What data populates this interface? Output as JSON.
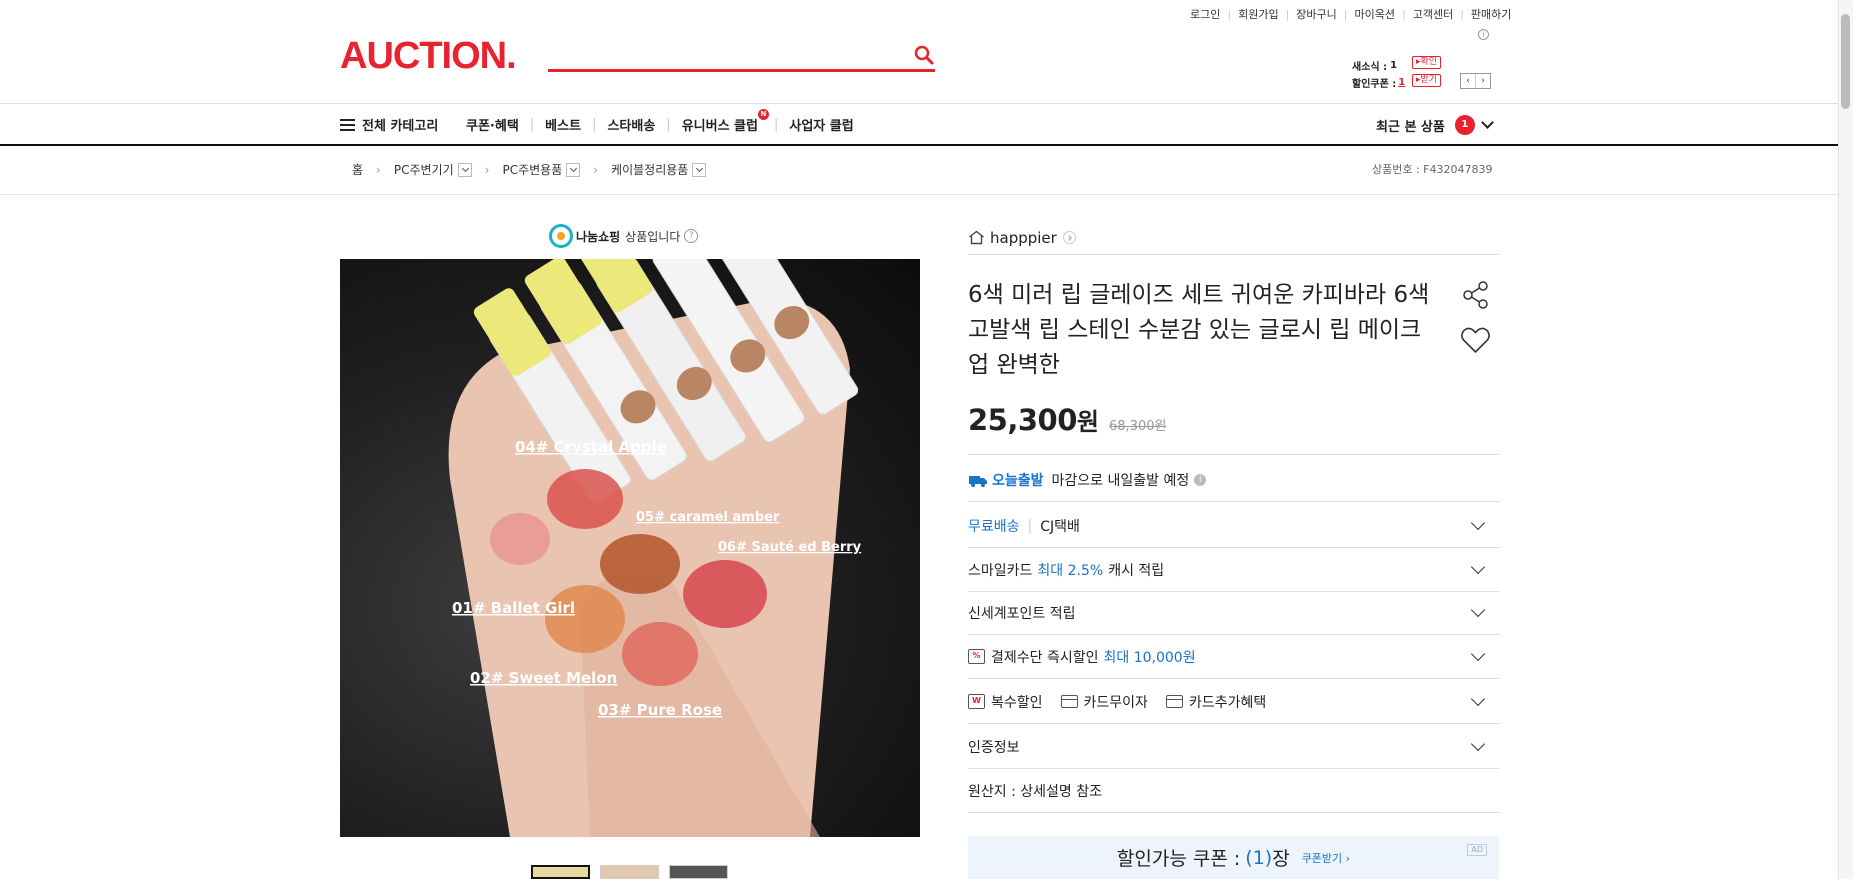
{
  "util_links": [
    "로그인",
    "회원가입",
    "장바구니",
    "마이옥션",
    "고객센터",
    "판매하기"
  ],
  "logo": "AUCTION.",
  "search": {
    "placeholder": "",
    "value": ""
  },
  "mini": {
    "news_label": "새소식 :",
    "news_count": "1",
    "news_btn": "확인",
    "coupon_label": "할인쿠폰 :",
    "coupon_count": "1",
    "coupon_btn": "받기"
  },
  "nav": {
    "all_category": "전체 카테고리",
    "links": [
      "쿠폰·혜택",
      "베스트",
      "스타배송",
      "유니버스 클럽",
      "사업자 클럽"
    ],
    "universe_badge": "N",
    "recent_label": "최근 본 상품",
    "recent_count": "1"
  },
  "breadcrumb": {
    "home": "홈",
    "items": [
      "PC주변기기",
      "PC주변용품",
      "케이블정리용품"
    ]
  },
  "product_id": "상품번호 : F432047839",
  "share_banner": {
    "brand": "나눔쇼핑",
    "text": "상품입니다"
  },
  "image_labels": [
    "04# Crystal Apple",
    "05# caramel amber",
    "06# Sauté ed Berry",
    "01# Ballet Girl",
    "02# Sweet Melon",
    "03# Pure Rose"
  ],
  "seller": "happpier",
  "title": "6색 미러 립 글레이즈 세트 귀여운 카피바라 6색 고발색 립 스테인 수분감 있는 글로시 립 메이크업 완벽한",
  "price": {
    "now": "25,300",
    "unit": "원",
    "old": "68,300원"
  },
  "shipping_today": {
    "badge": "오늘출발",
    "text": "마감으로 내일출발 예정"
  },
  "delivery": {
    "free": "무료배송",
    "carrier": "CJ택배"
  },
  "smilecard": {
    "pre": "스마일카드",
    "hl": "최대 2.5%",
    "post": "캐시 적립"
  },
  "ssg_point": "신세계포인트 적립",
  "payment": {
    "pre": "결제수단 즉시할인",
    "hl": "최대 10,000원"
  },
  "benefits": [
    "복수할인",
    "카드무이자",
    "카드추가혜택"
  ],
  "cert": "인증정보",
  "origin": "원산지 : 상세설명 참조",
  "coupon": {
    "pre": "할인가능 쿠폰 :",
    "count": "(1)",
    "post": "장",
    "get": "쿠폰받기 ›",
    "ad": "AD"
  },
  "colors": {
    "brand": "#e8222e",
    "link_blue": "#1a73c9"
  }
}
